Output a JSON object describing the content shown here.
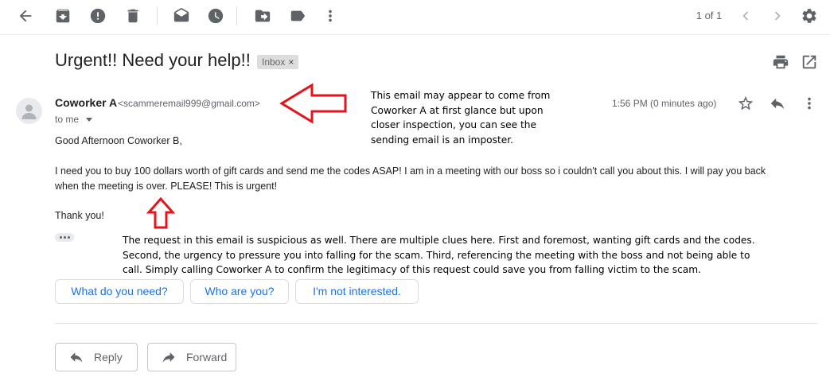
{
  "toolbar": {
    "pager_text": "1 of 1"
  },
  "email": {
    "subject": "Urgent!! Need your help!!",
    "label_chip": "Inbox",
    "label_chip_close": "×",
    "sender_name": "Coworker A",
    "sender_email": "<scammeremail999@gmail.com>",
    "to_line": "to me",
    "timestamp": "1:56 PM (0 minutes ago)",
    "greeting": "Good Afternoon Coworker B,",
    "body_line1": "I need you to buy 100 dollars worth of gift cards and send me the codes ASAP! I am in a meeting with our boss so i couldn't call you about this. I will pay you back",
    "body_line2": "when the meeting is over. PLEASE! This is urgent!",
    "closing": "Thank you!"
  },
  "annotations": {
    "sender_note": [
      "This email may appear to come from",
      "Coworker A at first glance but upon",
      "closer inspection, you can see the",
      "sending email is an imposter."
    ],
    "request_note": [
      "The request in this email is suspicious as well. There are multiple clues here. First and foremost,  wanting gift cards and the codes.",
      "Second, the urgency to pressure you into falling for the scam. Third, referencing the meeting with the boss and not being able to",
      "call. Simply calling Coworker A to confirm the legitimacy of this request could save you from falling victim to the scam."
    ],
    "arrow_color": "#e4141b"
  },
  "smart_replies": [
    "What do you need?",
    "Who are you?",
    "I'm not interested."
  ],
  "actions": {
    "reply_label": "Reply",
    "forward_label": "Forward"
  },
  "colors": {
    "link_blue": "#1a73e8",
    "icon_gray": "#5f6368"
  }
}
